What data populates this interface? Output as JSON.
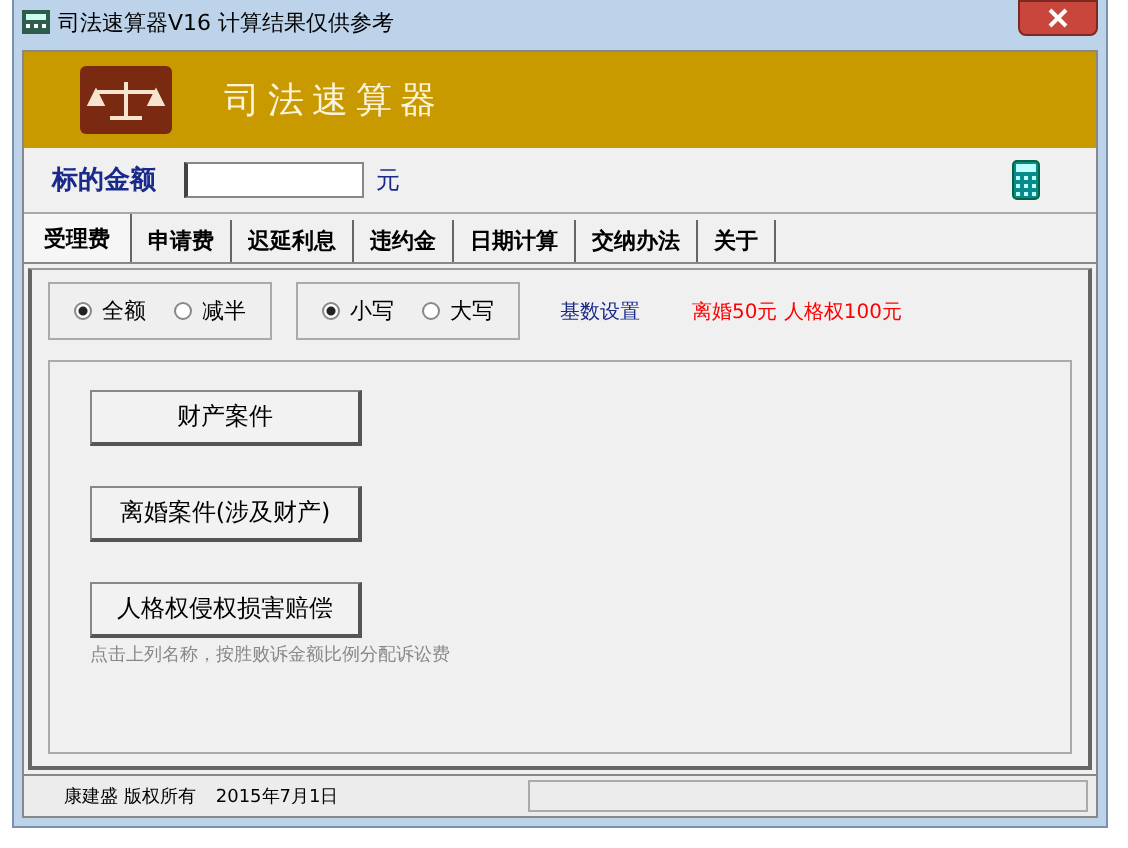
{
  "window": {
    "title": "司法速算器V16  计算结果仅供参考"
  },
  "banner": {
    "title": "司法速算器"
  },
  "amount": {
    "label": "标的金额",
    "unit": "元"
  },
  "tabs": [
    {
      "label": "受理费",
      "selected": true
    },
    {
      "label": "申请费",
      "selected": false
    },
    {
      "label": "迟延利息",
      "selected": false
    },
    {
      "label": "违约金",
      "selected": false
    },
    {
      "label": "日期计算",
      "selected": false
    },
    {
      "label": "交纳办法",
      "selected": false
    },
    {
      "label": "关于",
      "selected": false
    }
  ],
  "radio_groups": [
    {
      "options": [
        {
          "label": "全额",
          "selected": true
        },
        {
          "label": "减半",
          "selected": false
        }
      ]
    },
    {
      "options": [
        {
          "label": "小写",
          "selected": true
        },
        {
          "label": "大写",
          "selected": false
        }
      ]
    }
  ],
  "settings_link": "基数设置",
  "notice": "离婚50元  人格权100元",
  "case_buttons": [
    "财产案件",
    "离婚案件(涉及财产)",
    "人格权侵权损害赔偿"
  ],
  "hint": "点击上列名称，按胜败诉金额比例分配诉讼费",
  "status_bar": [
    "康建盛  版权所有",
    "2015年7月1日"
  ]
}
